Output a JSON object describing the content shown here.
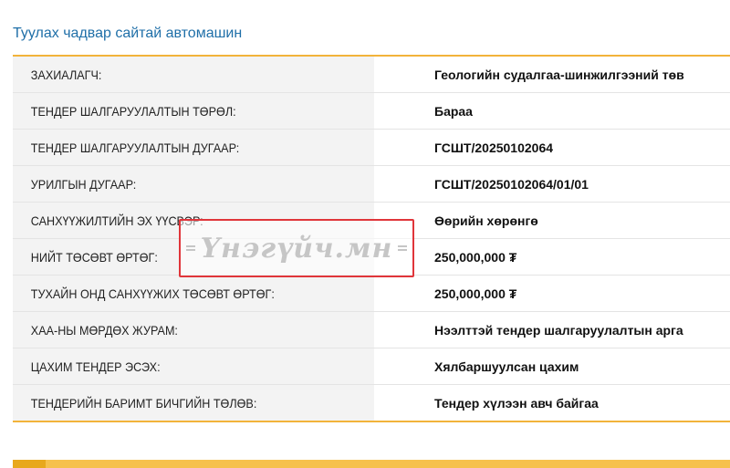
{
  "section": {
    "title": "Туулах чадвар сайтай автомашин"
  },
  "rows": [
    {
      "label": "ЗАХИАЛАГЧ:",
      "value": "Геологийн судалгаа-шинжилгээний төв"
    },
    {
      "label": "ТЕНДЕР ШАЛГАРУУЛАЛТЫН ТӨРӨЛ:",
      "value": "Бараа"
    },
    {
      "label": "ТЕНДЕР ШАЛГАРУУЛАЛТЫН ДУГААР:",
      "value": "ГСШТ/20250102064"
    },
    {
      "label": "УРИЛГЫН ДУГААР:",
      "value": "ГСШТ/20250102064/01/01"
    },
    {
      "label": "САНХҮҮЖИЛТИЙН ЭХ ҮҮСВЭР:",
      "value": "Өөрийн хөрөнгө"
    },
    {
      "label": "НИЙТ ТӨСӨВТ ӨРТӨГ:",
      "value": "250,000,000 ₮"
    },
    {
      "label": "ТУХАЙН ОНД САНХҮҮЖИХ ТӨСӨВТ ӨРТӨГ:",
      "value": "250,000,000 ₮"
    },
    {
      "label": "ХАА-НЫ МӨРДӨХ ЖУРАМ:",
      "value": "Нээлттэй тендер шалгаруулалтын арга"
    },
    {
      "label": "ЦАХИМ ТЕНДЕР ЭСЭХ:",
      "value": "Хялбаршуулсан цахим"
    },
    {
      "label": "ТЕНДЕРИЙН БАРИМТ БИЧГИЙН ТӨЛӨВ:",
      "value": "Тендер хүлээн авч байгаа"
    }
  ],
  "watermark": {
    "text": "Үнэгүйч.мн"
  },
  "colors": {
    "accent": "#f2b33a",
    "title": "#1f6fa8",
    "watermark_border": "#e0353a"
  }
}
